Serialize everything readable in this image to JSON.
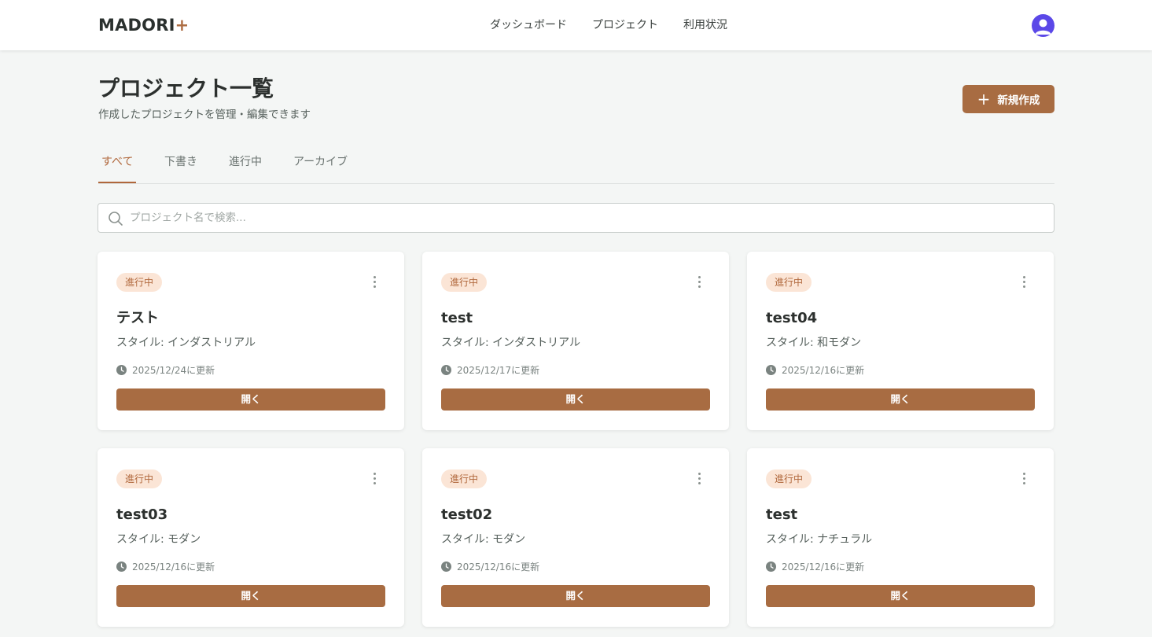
{
  "header": {
    "logo_text": "MADORI",
    "logo_plus": "+",
    "nav": [
      "ダッシュボード",
      "プロジェクト",
      "利用状況"
    ],
    "avatar_icon": "user-avatar-icon"
  },
  "page": {
    "title": "プロジェクト一覧",
    "subtitle": "作成したプロジェクトを管理・編集できます",
    "new_button_label": "新規作成"
  },
  "tabs": [
    "すべて",
    "下書き",
    "進行中",
    "アーカイブ"
  ],
  "active_tab": "すべて",
  "search": {
    "placeholder": "プロジェクト名で検索...",
    "value": ""
  },
  "projects": [
    {
      "status": "進行中",
      "name": "テスト",
      "style": "スタイル: インダストリアル",
      "updated": "2025/12/24に更新",
      "open_label": "開く"
    },
    {
      "status": "進行中",
      "name": "test",
      "style": "スタイル: インダストリアル",
      "updated": "2025/12/17に更新",
      "open_label": "開く"
    },
    {
      "status": "進行中",
      "name": "test04",
      "style": "スタイル: 和モダン",
      "updated": "2025/12/16に更新",
      "open_label": "開く"
    },
    {
      "status": "進行中",
      "name": "test03",
      "style": "スタイル: モダン",
      "updated": "2025/12/16に更新",
      "open_label": "開く"
    },
    {
      "status": "進行中",
      "name": "test02",
      "style": "スタイル: モダン",
      "updated": "2025/12/16に更新",
      "open_label": "開く"
    },
    {
      "status": "進行中",
      "name": "test",
      "style": "スタイル: ナチュラル",
      "updated": "2025/12/16に更新",
      "open_label": "開く"
    }
  ],
  "colors": {
    "accent": "#a86c42",
    "badge_bg": "#fbe5d6",
    "active_tab": "#b0673b",
    "avatar": "#5b48e8",
    "background": "#f4f6f5"
  }
}
